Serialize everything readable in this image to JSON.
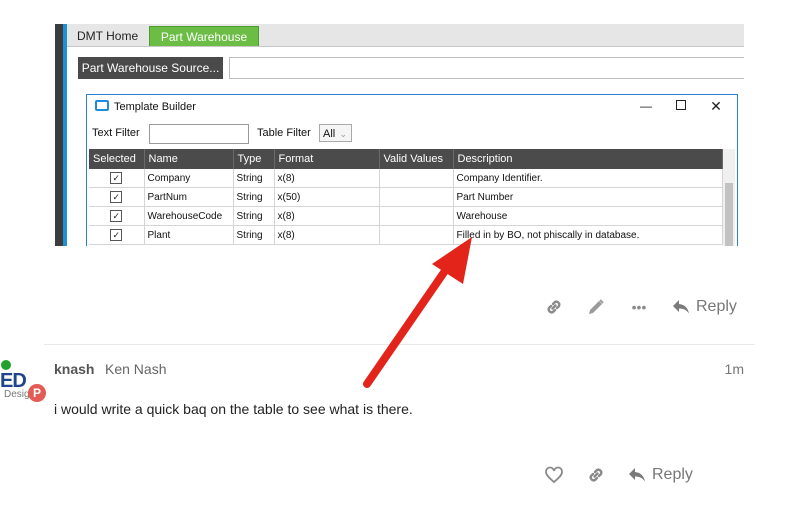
{
  "screenshot": {
    "tabs": [
      {
        "label": "DMT Home",
        "active": false
      },
      {
        "label": "Part Warehouse 1",
        "active": true
      }
    ],
    "source_button": "Part Warehouse Source...",
    "dialog": {
      "title": "Template Builder",
      "controls": {
        "minimize": "—",
        "close": "✕"
      },
      "text_filter_label": "Text Filter",
      "table_filter_label": "Table Filter",
      "table_filter_value": "All",
      "columns": [
        "Selected",
        "Name",
        "Type",
        "Format",
        "Valid Values",
        "Description"
      ],
      "rows": [
        {
          "checked": "✓",
          "name": "Company",
          "type": "String",
          "format": "x(8)",
          "valid": "",
          "desc": "Company Identifier."
        },
        {
          "checked": "✓",
          "name": "PartNum",
          "type": "String",
          "format": "x(50)",
          "valid": "",
          "desc": "Part Number"
        },
        {
          "checked": "✓",
          "name": "WarehouseCode",
          "type": "String",
          "format": "x(8)",
          "valid": "",
          "desc": "Warehouse"
        },
        {
          "checked": "✓",
          "name": "Plant",
          "type": "String",
          "format": "x(8)",
          "valid": "",
          "desc": "Filled in by BO, not phiscally in database."
        }
      ]
    }
  },
  "post_actions_top": {
    "reply_label": "Reply",
    "more": "•••"
  },
  "post": {
    "username": "knash",
    "full_name": "Ken Nash",
    "time": "1m",
    "avatar_text": "ED",
    "avatar_sub": "Desig",
    "badge": "P",
    "body": "i would write a quick baq on the table to see what is there."
  },
  "post_actions_bottom": {
    "reply_label": "Reply"
  },
  "colors": {
    "accent_green": "#6cbd45",
    "arrow_red": "#e3241b",
    "online": "#1fa12b"
  }
}
